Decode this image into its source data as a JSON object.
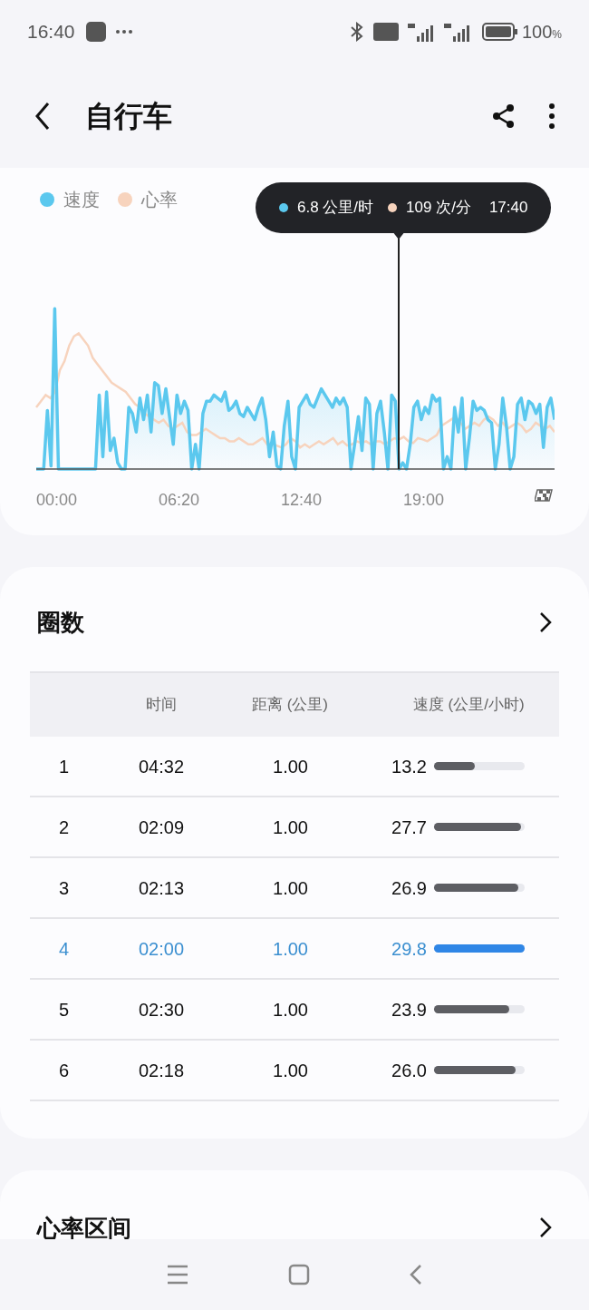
{
  "status_bar": {
    "time": "16:40",
    "battery": "100",
    "battery_unit": "%"
  },
  "header": {
    "title": "自行车"
  },
  "chart": {
    "legend": [
      {
        "label": "速度",
        "color": "#5bc8ee"
      },
      {
        "label": "心率",
        "color": "#f7d3bd"
      }
    ],
    "tooltip": {
      "speed": "6.8 公里/时",
      "heart_rate": "109 次/分",
      "time": "17:40"
    },
    "x_labels": [
      "00:00",
      "06:20",
      "12:40",
      "19:00"
    ]
  },
  "laps": {
    "title": "圈数",
    "columns": [
      "时间",
      "距离 (公里)",
      "速度 (公里/小时)"
    ],
    "rows": [
      {
        "lap": "1",
        "time": "04:32",
        "distance": "1.00",
        "speed": "13.2",
        "level": 0.45,
        "selected": false
      },
      {
        "lap": "2",
        "time": "02:09",
        "distance": "1.00",
        "speed": "27.7",
        "level": 0.96,
        "selected": false
      },
      {
        "lap": "3",
        "time": "02:13",
        "distance": "1.00",
        "speed": "26.9",
        "level": 0.93,
        "selected": false
      },
      {
        "lap": "4",
        "time": "02:00",
        "distance": "1.00",
        "speed": "29.8",
        "level": 1,
        "selected": true
      },
      {
        "lap": "5",
        "time": "02:30",
        "distance": "1.00",
        "speed": "23.9",
        "level": 0.83,
        "selected": false
      },
      {
        "lap": "6",
        "time": "02:18",
        "distance": "1.00",
        "speed": "26.0",
        "level": 0.9,
        "selected": false
      }
    ]
  },
  "heart_rate_zones": {
    "title": "心率区间"
  }
}
